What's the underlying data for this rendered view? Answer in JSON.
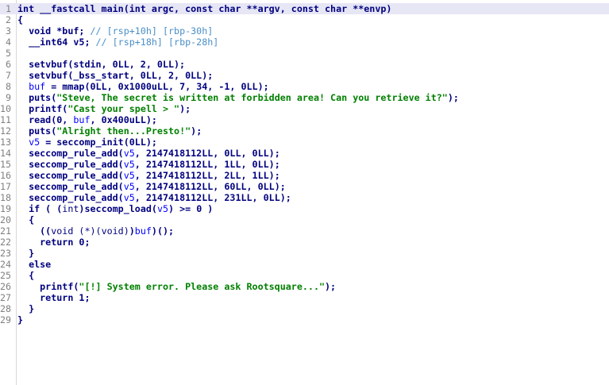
{
  "window": {
    "kind": "decompiler-pseudocode-view"
  },
  "lines": [
    {
      "n": "1",
      "tokens": [
        {
          "t": "int __fastcall main(int argc, const char **argv, const char **envp)",
          "c": "kw"
        }
      ],
      "highlighted": true
    },
    {
      "n": "2",
      "tokens": [
        {
          "t": "{",
          "c": "plain"
        }
      ]
    },
    {
      "n": "3",
      "tokens": [
        {
          "t": "  void *buf; ",
          "c": "plain"
        },
        {
          "t": "// [rsp+10h] [rbp-30h]",
          "c": "cmt"
        }
      ]
    },
    {
      "n": "4",
      "tokens": [
        {
          "t": "  __int64 v5; ",
          "c": "plain"
        },
        {
          "t": "// [rsp+18h] [rbp-28h]",
          "c": "cmt"
        }
      ]
    },
    {
      "n": "5",
      "tokens": [
        {
          "t": "",
          "c": "plain"
        }
      ]
    },
    {
      "n": "6",
      "tokens": [
        {
          "t": "  setvbuf(stdin, 0LL, 2, 0LL);",
          "c": "plain"
        }
      ]
    },
    {
      "n": "7",
      "tokens": [
        {
          "t": "  setvbuf(_bss_start, 0LL, 2, 0LL);",
          "c": "plain"
        }
      ]
    },
    {
      "n": "8",
      "tokens": [
        {
          "t": "  ",
          "c": "plain"
        },
        {
          "t": "buf",
          "c": "var"
        },
        {
          "t": " = mmap(0LL, 0x1000uLL, 7, 34, -1, 0LL);",
          "c": "plain"
        }
      ]
    },
    {
      "n": "9",
      "tokens": [
        {
          "t": "  puts(",
          "c": "plain"
        },
        {
          "t": "\"Steve, The secret is written at forbidden area! Can you retrieve it?\"",
          "c": "str"
        },
        {
          "t": ");",
          "c": "plain"
        }
      ]
    },
    {
      "n": "10",
      "tokens": [
        {
          "t": "  printf(",
          "c": "plain"
        },
        {
          "t": "\"Cast your spell > \"",
          "c": "str"
        },
        {
          "t": ");",
          "c": "plain"
        }
      ]
    },
    {
      "n": "11",
      "tokens": [
        {
          "t": "  read(0, ",
          "c": "plain"
        },
        {
          "t": "buf",
          "c": "var"
        },
        {
          "t": ", 0x400uLL);",
          "c": "plain"
        }
      ]
    },
    {
      "n": "12",
      "tokens": [
        {
          "t": "  puts(",
          "c": "plain"
        },
        {
          "t": "\"Alright then...Presto!\"",
          "c": "str"
        },
        {
          "t": ");",
          "c": "plain"
        }
      ]
    },
    {
      "n": "13",
      "tokens": [
        {
          "t": "  ",
          "c": "plain"
        },
        {
          "t": "v5",
          "c": "var"
        },
        {
          "t": " = seccomp_init(0LL);",
          "c": "plain"
        }
      ]
    },
    {
      "n": "14",
      "tokens": [
        {
          "t": "  seccomp_rule_add(",
          "c": "plain"
        },
        {
          "t": "v5",
          "c": "var"
        },
        {
          "t": ", 2147418112LL, 0LL, 0LL);",
          "c": "plain"
        }
      ]
    },
    {
      "n": "15",
      "tokens": [
        {
          "t": "  seccomp_rule_add(",
          "c": "plain"
        },
        {
          "t": "v5",
          "c": "var"
        },
        {
          "t": ", 2147418112LL, 1LL, 0LL);",
          "c": "plain"
        }
      ]
    },
    {
      "n": "16",
      "tokens": [
        {
          "t": "  seccomp_rule_add(",
          "c": "plain"
        },
        {
          "t": "v5",
          "c": "var"
        },
        {
          "t": ", 2147418112LL, 2LL, 1LL);",
          "c": "plain"
        }
      ]
    },
    {
      "n": "17",
      "tokens": [
        {
          "t": "  seccomp_rule_add(",
          "c": "plain"
        },
        {
          "t": "v5",
          "c": "var"
        },
        {
          "t": ", 2147418112LL, 60LL, 0LL);",
          "c": "plain"
        }
      ]
    },
    {
      "n": "18",
      "tokens": [
        {
          "t": "  seccomp_rule_add(",
          "c": "plain"
        },
        {
          "t": "v5",
          "c": "var"
        },
        {
          "t": ", 2147418112LL, 231LL, 0LL);",
          "c": "plain"
        }
      ]
    },
    {
      "n": "19",
      "tokens": [
        {
          "t": "  if ( (",
          "c": "plain"
        },
        {
          "t": "int",
          "c": "cast"
        },
        {
          "t": ")seccomp_load(",
          "c": "plain"
        },
        {
          "t": "v5",
          "c": "var"
        },
        {
          "t": ") >= 0 )",
          "c": "plain"
        }
      ]
    },
    {
      "n": "20",
      "tokens": [
        {
          "t": "  {",
          "c": "plain"
        }
      ]
    },
    {
      "n": "21",
      "tokens": [
        {
          "t": "    ((",
          "c": "plain"
        },
        {
          "t": "void (*)(void)",
          "c": "cast"
        },
        {
          "t": ")",
          "c": "plain"
        },
        {
          "t": "buf",
          "c": "var"
        },
        {
          "t": ")();",
          "c": "plain"
        }
      ]
    },
    {
      "n": "22",
      "tokens": [
        {
          "t": "    return 0;",
          "c": "plain"
        }
      ]
    },
    {
      "n": "23",
      "tokens": [
        {
          "t": "  }",
          "c": "plain"
        }
      ]
    },
    {
      "n": "24",
      "tokens": [
        {
          "t": "  else",
          "c": "plain"
        }
      ]
    },
    {
      "n": "25",
      "tokens": [
        {
          "t": "  {",
          "c": "plain"
        }
      ]
    },
    {
      "n": "26",
      "tokens": [
        {
          "t": "    printf(",
          "c": "plain"
        },
        {
          "t": "\"[!] System error. Please ask Rootsquare...\"",
          "c": "str"
        },
        {
          "t": ");",
          "c": "plain"
        }
      ]
    },
    {
      "n": "27",
      "tokens": [
        {
          "t": "    return 1;",
          "c": "plain"
        }
      ]
    },
    {
      "n": "28",
      "tokens": [
        {
          "t": "  }",
          "c": "plain"
        }
      ]
    },
    {
      "n": "29",
      "tokens": [
        {
          "t": "}",
          "c": "plain"
        }
      ]
    }
  ]
}
